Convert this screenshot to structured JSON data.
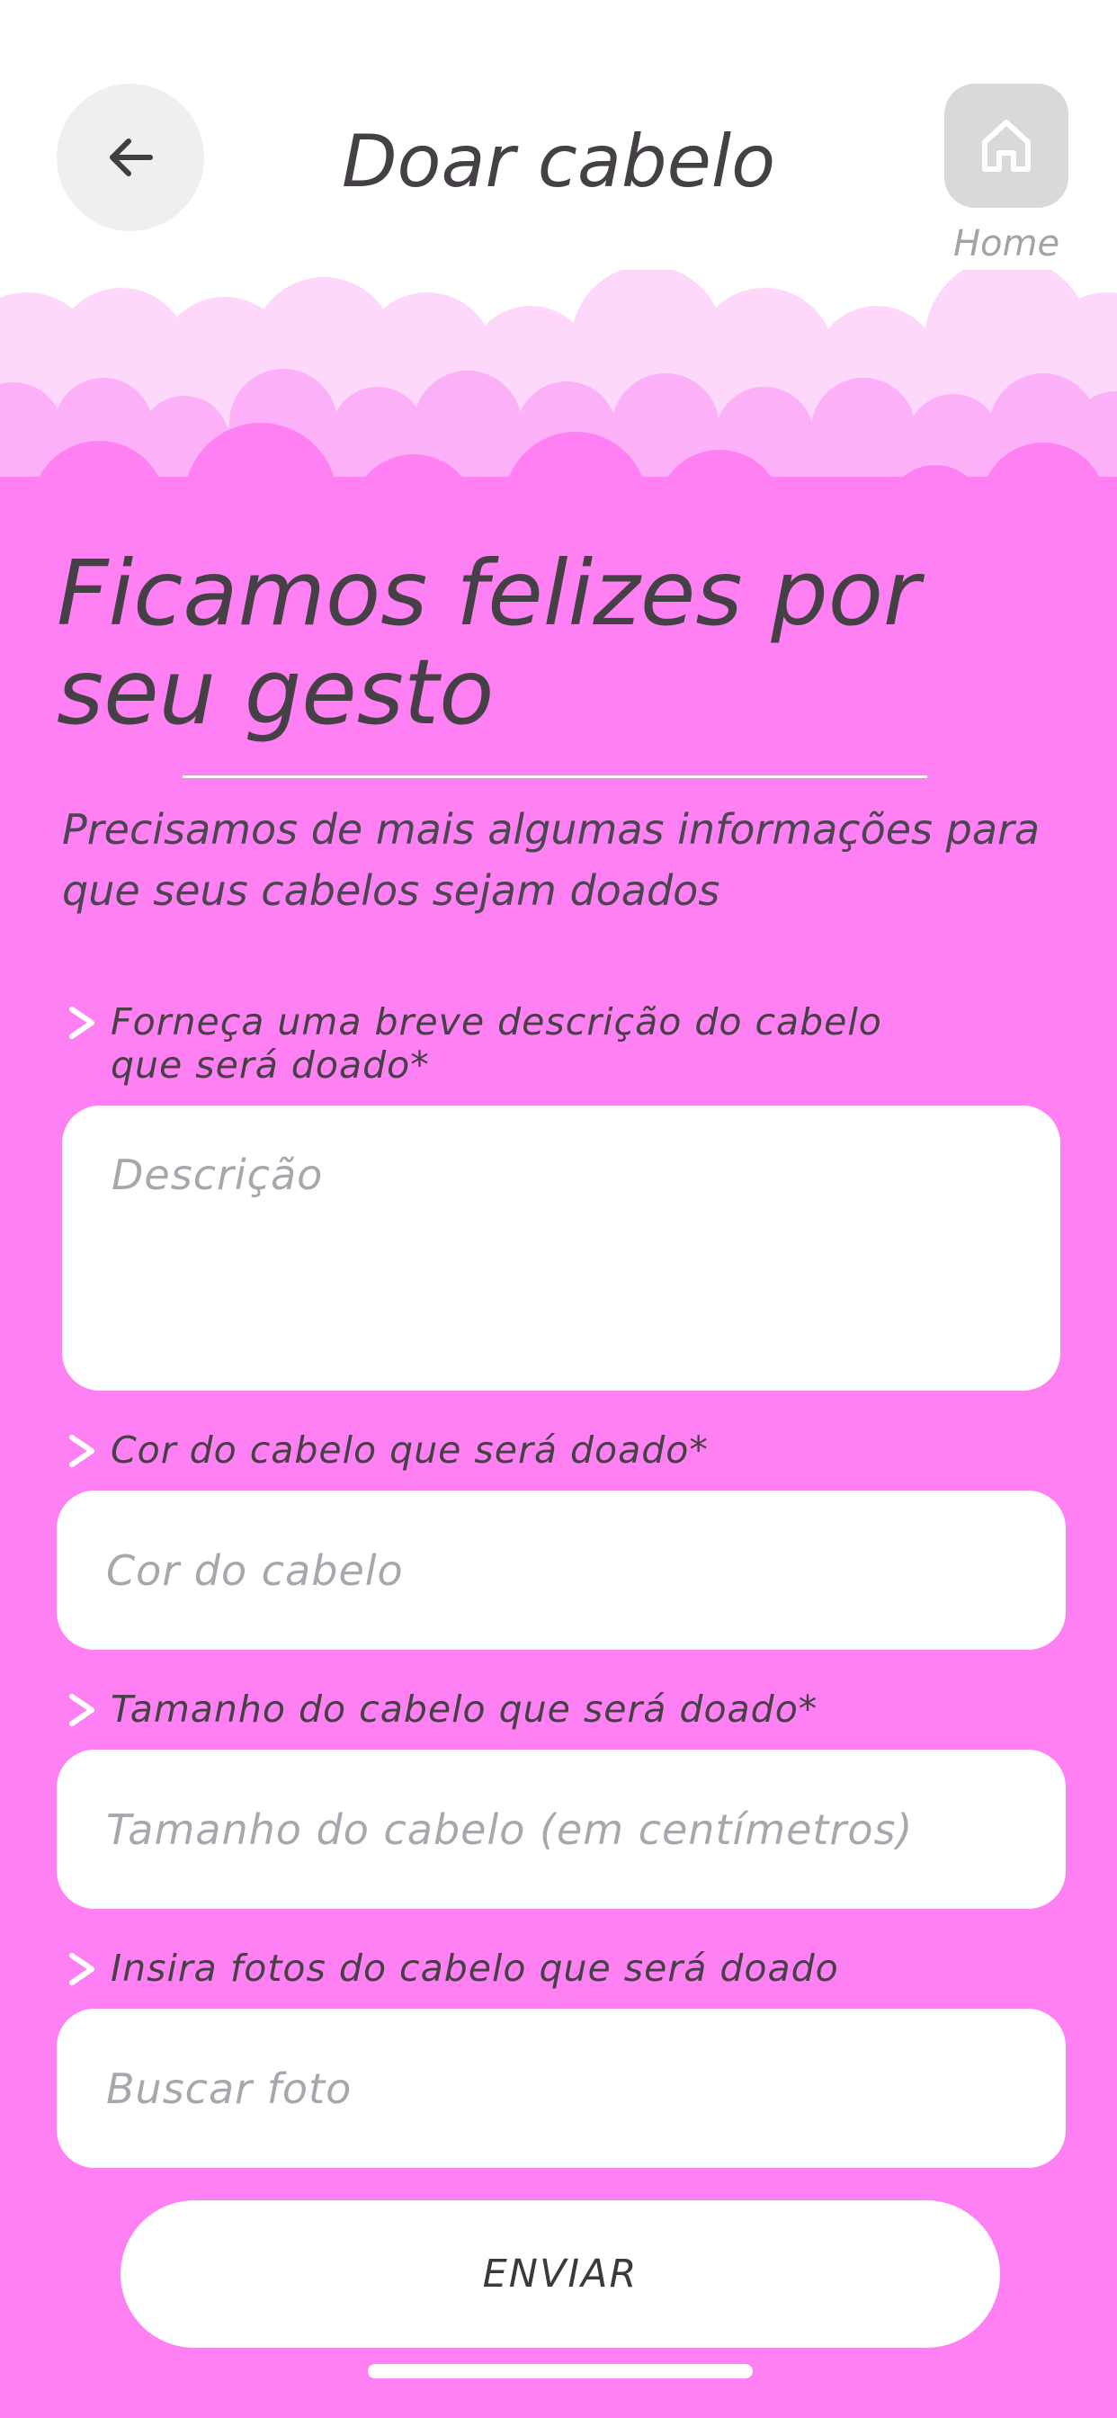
{
  "header": {
    "title": "Doar cabelo",
    "home_label": "Home"
  },
  "hero": {
    "line1": "Ficamos felizes por",
    "line2": "seu gesto",
    "subtitle_line1": "Precisamos de mais algumas informações para",
    "subtitle_line2": "que seus cabelos sejam doados"
  },
  "form": {
    "description": {
      "label_line1": "Forneça uma breve descrição do cabelo",
      "label_line2": "que será doado*",
      "placeholder": "Descrição"
    },
    "color": {
      "label": "Cor do cabelo que será doado*",
      "placeholder": "Cor do cabelo"
    },
    "size": {
      "label": "Tamanho do cabelo que será doado*",
      "placeholder": "Tamanho do cabelo (em centímetros)"
    },
    "photos": {
      "label": "Insira fotos do cabelo que será doado",
      "placeholder": "Buscar foto"
    },
    "submit_label": "ENVIAR"
  },
  "colors": {
    "background": "#ff80f3",
    "cloud_light": "#fdd8fb",
    "cloud_mid": "#fcb0f7",
    "text": "#454045",
    "placeholder": "#a9a6ae"
  },
  "icons": {
    "back": "arrow-left-icon",
    "home": "home-icon",
    "chevron": "chevron-right-icon"
  }
}
